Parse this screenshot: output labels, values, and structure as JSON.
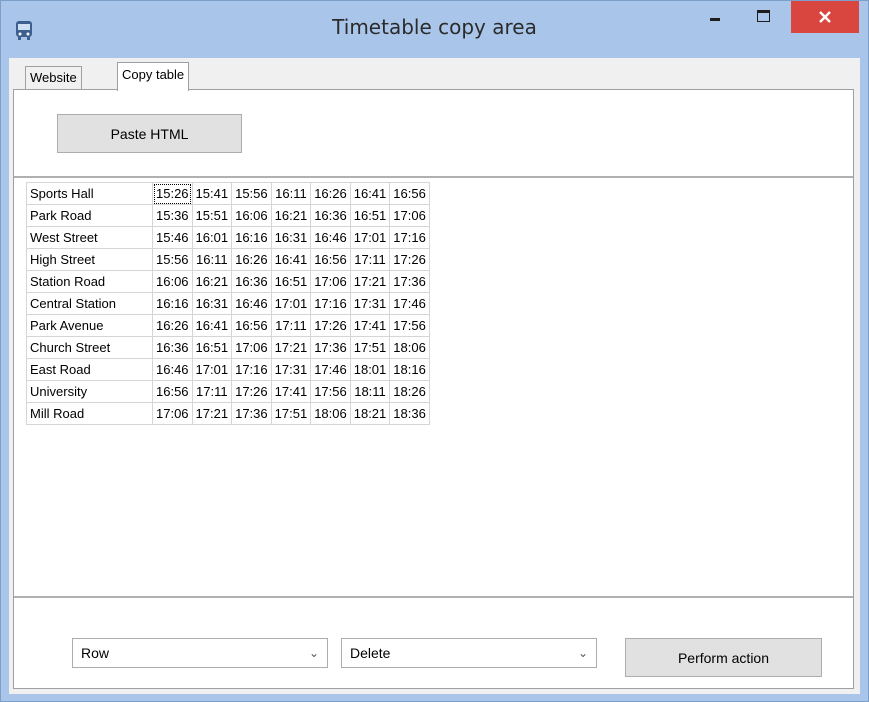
{
  "window": {
    "title": "Timetable copy area"
  },
  "tabs": [
    {
      "label": "Website"
    },
    {
      "label": "Copy table"
    }
  ],
  "toolbar": {
    "paste_label": "Paste HTML"
  },
  "timetable": {
    "rows": [
      {
        "stop": "Sports Hall",
        "times": [
          "15:26",
          "15:41",
          "15:56",
          "16:11",
          "16:26",
          "16:41",
          "16:56"
        ]
      },
      {
        "stop": "Park Road",
        "times": [
          "15:36",
          "15:51",
          "16:06",
          "16:21",
          "16:36",
          "16:51",
          "17:06"
        ]
      },
      {
        "stop": "West Street",
        "times": [
          "15:46",
          "16:01",
          "16:16",
          "16:31",
          "16:46",
          "17:01",
          "17:16"
        ]
      },
      {
        "stop": "High Street",
        "times": [
          "15:56",
          "16:11",
          "16:26",
          "16:41",
          "16:56",
          "17:11",
          "17:26"
        ]
      },
      {
        "stop": "Station Road",
        "times": [
          "16:06",
          "16:21",
          "16:36",
          "16:51",
          "17:06",
          "17:21",
          "17:36"
        ]
      },
      {
        "stop": "Central Station",
        "times": [
          "16:16",
          "16:31",
          "16:46",
          "17:01",
          "17:16",
          "17:31",
          "17:46"
        ]
      },
      {
        "stop": "Park Avenue",
        "times": [
          "16:26",
          "16:41",
          "16:56",
          "17:11",
          "17:26",
          "17:41",
          "17:56"
        ]
      },
      {
        "stop": "Church Street",
        "times": [
          "16:36",
          "16:51",
          "17:06",
          "17:21",
          "17:36",
          "17:51",
          "18:06"
        ]
      },
      {
        "stop": "East Road",
        "times": [
          "16:46",
          "17:01",
          "17:16",
          "17:31",
          "17:46",
          "18:01",
          "18:16"
        ]
      },
      {
        "stop": "University",
        "times": [
          "16:56",
          "17:11",
          "17:26",
          "17:41",
          "17:56",
          "18:11",
          "18:26"
        ]
      },
      {
        "stop": "Mill Road",
        "times": [
          "17:06",
          "17:21",
          "17:36",
          "17:51",
          "18:06",
          "18:21",
          "18:36"
        ]
      }
    ]
  },
  "bottom": {
    "target_select": "Row",
    "action_select": "Delete",
    "perform_label": "Perform action"
  }
}
